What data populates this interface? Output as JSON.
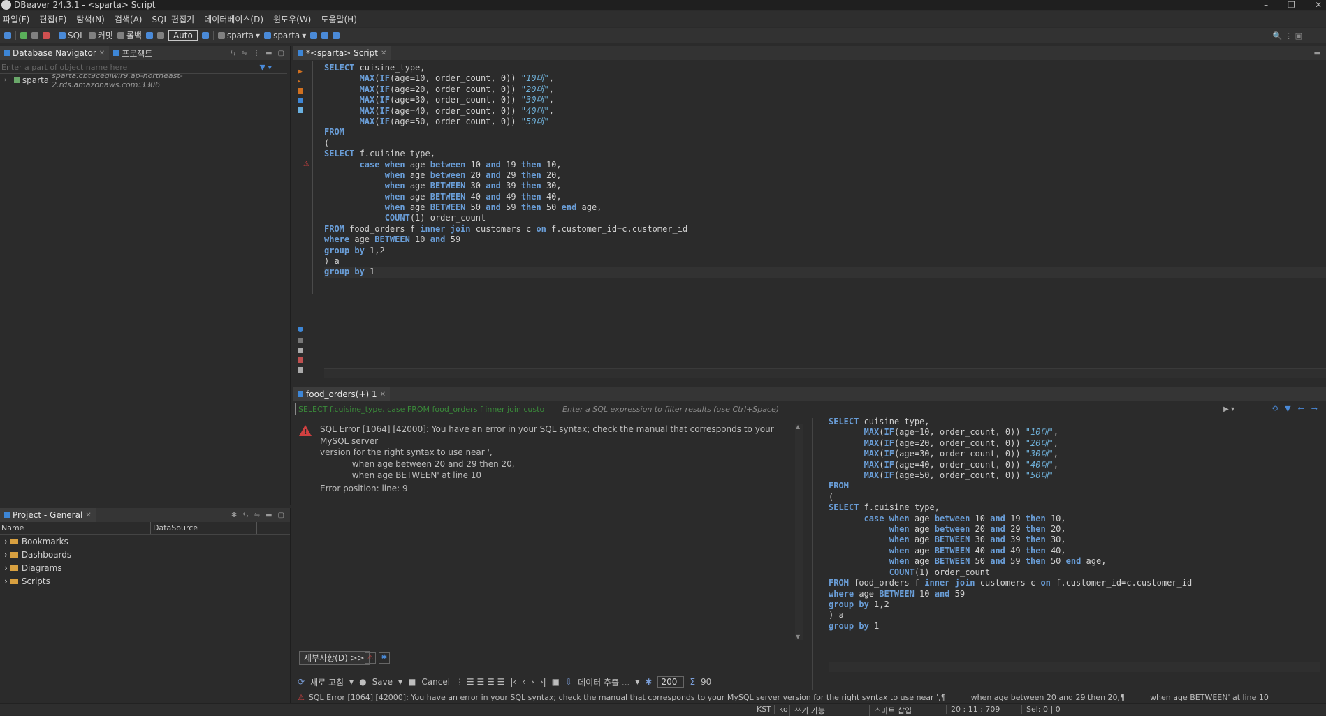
{
  "window": {
    "title": "DBeaver 24.3.1 - <sparta> Script"
  },
  "menu": [
    "파일(F)",
    "편집(E)",
    "탐색(N)",
    "검색(A)",
    "SQL 편집기",
    "데이터베이스(D)",
    "윈도우(W)",
    "도움말(H)"
  ],
  "toolbar": {
    "sql_label": "SQL",
    "commit_label": "커밋",
    "rollback_label": "롤백",
    "auto_label": "Auto",
    "schema1": "sparta",
    "schema2": "sparta"
  },
  "navigator": {
    "tab_label": "Database Navigator",
    "tab2_label": "프로젝트",
    "filter_placeholder": "Enter a part of object name here",
    "connection": {
      "name": "sparta",
      "host": "sparta.cbt9ceqiwlr9.ap-northeast-2.rds.amazonaws.com:3306"
    }
  },
  "project": {
    "tab_label": "Project - General",
    "columns": [
      "Name",
      "DataSource"
    ],
    "items": [
      "Bookmarks",
      "Dashboards",
      "Diagrams",
      "Scripts"
    ]
  },
  "editor": {
    "tab_label": "*<sparta> Script",
    "lines": [
      [
        [
          "kw",
          "SELECT"
        ],
        [
          "fn",
          " cuisine_type,"
        ]
      ],
      [
        [
          "fn",
          "       "
        ],
        [
          "kw",
          "MAX"
        ],
        [
          "fn",
          "("
        ],
        [
          "kw",
          "IF"
        ],
        [
          "fn",
          "(age=10, order_count, 0)) "
        ],
        [
          "str",
          "\"10대\""
        ],
        [
          "fn",
          ","
        ]
      ],
      [
        [
          "fn",
          "       "
        ],
        [
          "kw",
          "MAX"
        ],
        [
          "fn",
          "("
        ],
        [
          "kw",
          "IF"
        ],
        [
          "fn",
          "(age=20, order_count, 0)) "
        ],
        [
          "str",
          "\"20대\""
        ],
        [
          "fn",
          ","
        ]
      ],
      [
        [
          "fn",
          "       "
        ],
        [
          "kw",
          "MAX"
        ],
        [
          "fn",
          "("
        ],
        [
          "kw",
          "IF"
        ],
        [
          "fn",
          "(age=30, order_count, 0)) "
        ],
        [
          "str",
          "\"30대\""
        ],
        [
          "fn",
          ","
        ]
      ],
      [
        [
          "fn",
          "       "
        ],
        [
          "kw",
          "MAX"
        ],
        [
          "fn",
          "("
        ],
        [
          "kw",
          "IF"
        ],
        [
          "fn",
          "(age=40, order_count, 0)) "
        ],
        [
          "str",
          "\"40대\""
        ],
        [
          "fn",
          ","
        ]
      ],
      [
        [
          "fn",
          "       "
        ],
        [
          "kw",
          "MAX"
        ],
        [
          "fn",
          "("
        ],
        [
          "kw",
          "IF"
        ],
        [
          "fn",
          "(age=50, order_count, 0)) "
        ],
        [
          "str",
          "\"50대\""
        ]
      ],
      [
        [
          "kw",
          "FROM"
        ]
      ],
      [
        [
          "fn",
          "("
        ]
      ],
      [
        [
          "kw",
          "SELECT"
        ],
        [
          "fn",
          " f.cuisine_type,"
        ]
      ],
      [
        [
          "fn",
          "       "
        ],
        [
          "kw",
          "case when"
        ],
        [
          "fn",
          " age "
        ],
        [
          "kw",
          "between"
        ],
        [
          "fn",
          " 10 "
        ],
        [
          "kw",
          "and"
        ],
        [
          "fn",
          " 19 "
        ],
        [
          "kw",
          "then"
        ],
        [
          "fn",
          " 10,"
        ]
      ],
      [
        [
          "fn",
          "            "
        ],
        [
          "kw",
          "when"
        ],
        [
          "fn",
          " age "
        ],
        [
          "kw",
          "between"
        ],
        [
          "fn",
          " 20 "
        ],
        [
          "kw",
          "and"
        ],
        [
          "fn",
          " 29 "
        ],
        [
          "kw",
          "then"
        ],
        [
          "fn",
          " 20,"
        ]
      ],
      [
        [
          "fn",
          "            "
        ],
        [
          "kw",
          "when"
        ],
        [
          "fn",
          " age "
        ],
        [
          "kw",
          "BETWEEN"
        ],
        [
          "fn",
          " 30 "
        ],
        [
          "kw",
          "and"
        ],
        [
          "fn",
          " 39 "
        ],
        [
          "kw",
          "then"
        ],
        [
          "fn",
          " 30,"
        ]
      ],
      [
        [
          "fn",
          "            "
        ],
        [
          "kw",
          "when"
        ],
        [
          "fn",
          " age "
        ],
        [
          "kw",
          "BETWEEN"
        ],
        [
          "fn",
          " 40 "
        ],
        [
          "kw",
          "and"
        ],
        [
          "fn",
          " 49 "
        ],
        [
          "kw",
          "then"
        ],
        [
          "fn",
          " 40,"
        ]
      ],
      [
        [
          "fn",
          "            "
        ],
        [
          "kw",
          "when"
        ],
        [
          "fn",
          " age "
        ],
        [
          "kw",
          "BETWEEN"
        ],
        [
          "fn",
          " 50 "
        ],
        [
          "kw",
          "and"
        ],
        [
          "fn",
          " 59 "
        ],
        [
          "kw",
          "then"
        ],
        [
          "fn",
          " 50 "
        ],
        [
          "kw",
          "end"
        ],
        [
          "fn",
          " age,"
        ]
      ],
      [
        [
          "fn",
          "            "
        ],
        [
          "kw",
          "COUNT"
        ],
        [
          "fn",
          "(1) order_count"
        ]
      ],
      [
        [
          "kw",
          "FROM"
        ],
        [
          "fn",
          " food_orders f "
        ],
        [
          "kw",
          "inner join"
        ],
        [
          "fn",
          " customers c "
        ],
        [
          "kw",
          "on"
        ],
        [
          "fn",
          " f.customer_id=c.customer_id"
        ]
      ],
      [
        [
          "kw",
          "where"
        ],
        [
          "fn",
          " age "
        ],
        [
          "kw",
          "BETWEEN"
        ],
        [
          "fn",
          " 10 "
        ],
        [
          "kw",
          "and"
        ],
        [
          "fn",
          " 59"
        ]
      ],
      [
        [
          "kw",
          "group by"
        ],
        [
          "fn",
          " 1,2"
        ]
      ],
      [
        [
          "fn",
          ") a"
        ]
      ],
      [
        [
          "kw",
          "group by"
        ],
        [
          "fn",
          " 1"
        ]
      ]
    ]
  },
  "results": {
    "tab_label": "food_orders(+) 1",
    "filter_query": "SELECT f.cuisine_type, case FROM food_orders f inner join custo",
    "filter_placeholder": "Enter a SQL expression to filter results (use Ctrl+Space)",
    "error": {
      "line1": "SQL Error [1064] [42000]: You have an error in your SQL syntax; check the manual that corresponds to your MySQL server",
      "line2": "version for the right syntax to use near ',",
      "line3": "            when age between 20 and 29 then 20,",
      "line4": "            when age BETWEEN' at line 10",
      "position": "Error position: line: 9"
    },
    "detail_label": "세부사항(D) >>",
    "bottom": {
      "refresh": "새로 고침",
      "save": "Save",
      "cancel": "Cancel",
      "export": "데이터 추출 ...",
      "fetch_size": "200",
      "count": "90"
    },
    "status_error": {
      "part1": "SQL Error [1064] [42000]: You have an error in your SQL syntax; check the manual that corresponds to your MySQL server version for the right syntax to use near ',¶",
      "part2": "when age between 20 and 29 then 20,¶",
      "part3": "when age BETWEEN' at line 10"
    }
  },
  "statusbar": {
    "tz": "KST",
    "lang": "ko",
    "mode": "쓰기 가능",
    "insert": "스마트 삽입",
    "pos": "20 : 11 : 709",
    "sel": "Sel: 0 | 0"
  }
}
